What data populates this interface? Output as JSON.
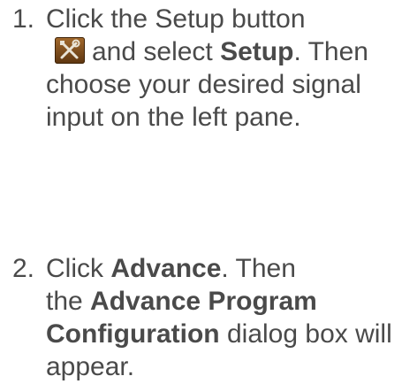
{
  "steps": [
    {
      "number": "1.",
      "line1": "Click the Setup button",
      "line2_after_icon": "and select ",
      "line2_bold": "Setup",
      "line2_end": ". Then",
      "line3": "choose your desired signal",
      "line4": "input on the left pane.",
      "icon": "setup-tools-icon"
    },
    {
      "number": "2.",
      "line1_start": "Click ",
      "line1_bold": "Advance",
      "line1_end": ". Then",
      "line2_start": "the ",
      "line2_bold": "Advance Program",
      "line3_bold": "Configuration",
      "line3_end": " dialog box will",
      "line4": "appear."
    }
  ],
  "colors": {
    "text": "#4a4a4a",
    "icon_bg": "#7a4a1c",
    "icon_tools": "#e9e3d6"
  }
}
